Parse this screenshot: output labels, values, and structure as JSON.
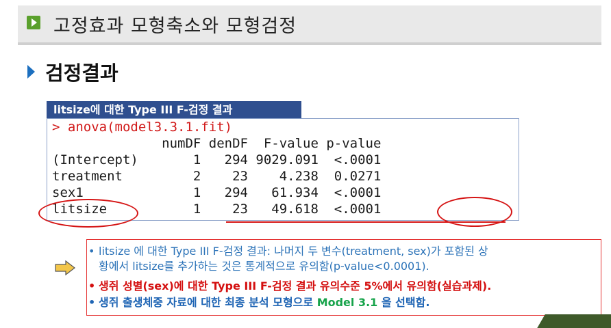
{
  "title": "고정효과 모형축소와 모형검정",
  "section": "검정결과",
  "table": {
    "caption": "litsize에 대한 Type III F-검정 결과",
    "command": "> anova(model3.3.1.fit)",
    "header": "              numDF denDF  F-value p-value",
    "rows": [
      "(Intercept)       1   294 9029.091  <.0001",
      "treatment         2    23    4.238  0.0271",
      "sex1              1   294   61.934  <.0001",
      "litsize           1    23   49.618  <.0001"
    ]
  },
  "notes": {
    "bullet": "•",
    "line1": "litsize 에 대한 Type III F-검정 결과: 나머지 두 변수(treatment, sex)가 포함된 상",
    "line1b": "황에서 litsize를 추가하는 것은 통계적으로 유의함(p-value<0.0001).",
    "line2": "생쥐 성별(sex)에 대한 Type III F-검정 결과 유의수준 5%에서 유의함(실습과제).",
    "line3a": "생쥐 출생체중 자료에 대한 최종 분석 모형으로 ",
    "line3b": "Model 3.1",
    "line3c": " 을 선택함."
  },
  "colors": {
    "accent_blue": "#2c73b8",
    "highlight_red": "#d40f0f",
    "model_green": "#16a34a",
    "caption_bg": "#2f4f8f"
  }
}
